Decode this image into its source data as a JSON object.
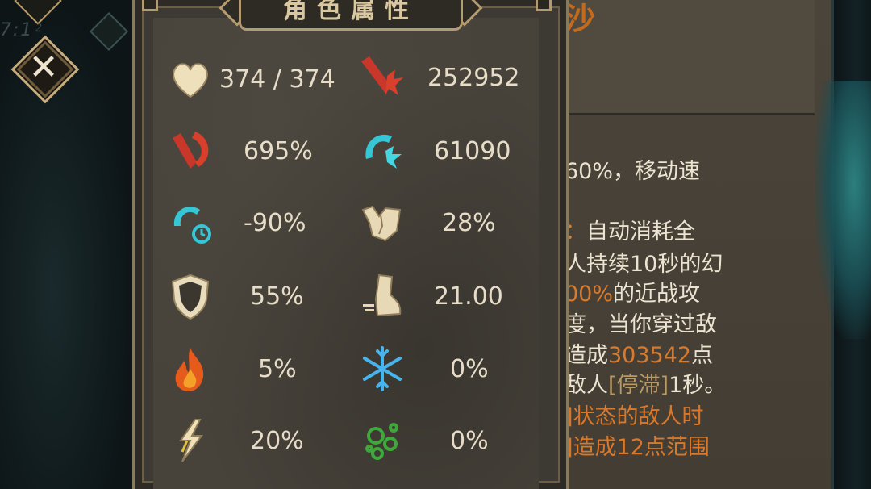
{
  "hud": {
    "time_fragment": "7:1⁲"
  },
  "close_button": {
    "label": "✕"
  },
  "stats_panel": {
    "title": "角色属性",
    "stats": [
      {
        "icon": "heart-icon",
        "value": "374 / 374"
      },
      {
        "icon": "damage-icon",
        "value": "252952"
      },
      {
        "icon": "crit-damage-icon",
        "value": "695%"
      },
      {
        "icon": "attack-speed-icon",
        "value": "61090"
      },
      {
        "icon": "cooldown-icon",
        "value": "-90%"
      },
      {
        "icon": "dodge-icon",
        "value": "28%"
      },
      {
        "icon": "armor-shield-icon",
        "value": "55%"
      },
      {
        "icon": "boot-speed-icon",
        "value": "21.00"
      },
      {
        "icon": "fire-icon",
        "value": "5%"
      },
      {
        "icon": "frost-snowflake-icon",
        "value": "0%"
      },
      {
        "icon": "lightning-icon",
        "value": "20%"
      },
      {
        "icon": "poison-icon",
        "value": "0%"
      }
    ]
  },
  "description_panel": {
    "title_fragment": "沙",
    "line1": "60%，移动速",
    "line2_prefix": "：",
    "line2_text": "自动消耗全",
    "line3": "人持续10秒的幻",
    "line4_highlight": "00%",
    "line4_text": "的近战攻",
    "line5": "度，当你穿过敌",
    "line6_text": "造成",
    "line6_highlight": "303542",
    "line6_suffix": "点",
    "line7_text": "敌人",
    "line7_tag": "[停滞]",
    "line7_suffix": "1秒。",
    "line8": "]状态的敌人时",
    "line9": "]造成12点范围"
  },
  "colors": {
    "panel_bg": "#47433b",
    "frame_gold": "#b49c70",
    "value_text": "#e6dcc7",
    "highlight_orange": "#d97a2c"
  }
}
